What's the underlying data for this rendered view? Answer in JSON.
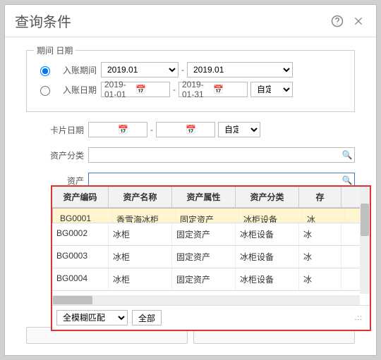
{
  "title": "查询条件",
  "period": {
    "legend": "期间 日期",
    "rowA": {
      "label": "入账期间",
      "from": "2019.01",
      "to": "2019.01"
    },
    "rowB": {
      "label": "入账日期",
      "from": "2019-01-01",
      "to": "2019-01-31",
      "mode": "自定义"
    }
  },
  "card": {
    "label": "卡片日期",
    "from": "",
    "to": "",
    "mode": "自定义"
  },
  "classify": {
    "label": "资产分类",
    "value": ""
  },
  "asset": {
    "label": "资产",
    "value": ""
  },
  "grid": {
    "headers": [
      "资产编码",
      "资产名称",
      "资产属性",
      "资产分类",
      "存"
    ],
    "rows": [
      {
        "code": "BG0001",
        "name": "香雪海冰柜",
        "attr": "固定资产",
        "cls": "冰柜设备",
        "ext": "冰"
      },
      {
        "code": "BG0002",
        "name": "冰柜",
        "attr": "固定资产",
        "cls": "冰柜设备",
        "ext": "冰"
      },
      {
        "code": "BG0003",
        "name": "冰柜",
        "attr": "固定资产",
        "cls": "冰柜设备",
        "ext": "冰"
      },
      {
        "code": "BG0004",
        "name": "冰柜",
        "attr": "固定资产",
        "cls": "冰柜设备",
        "ext": "冰"
      }
    ]
  },
  "footer": {
    "match": "全模糊匹配",
    "all": "全部"
  }
}
